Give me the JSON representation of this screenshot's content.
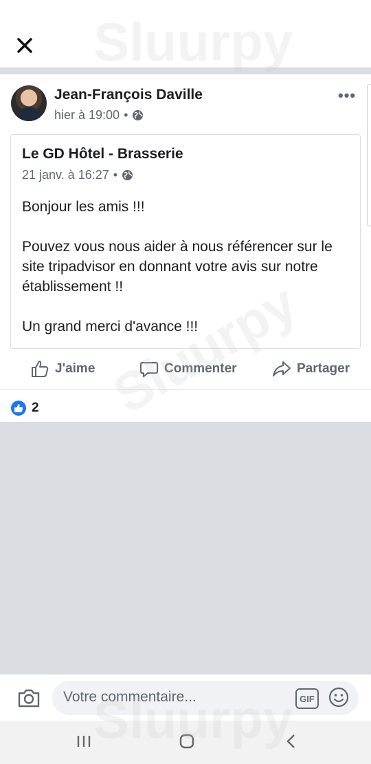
{
  "header": {
    "close_icon": "close-icon"
  },
  "post": {
    "author": "Jean-François Daville",
    "time": "hier à 19:00",
    "separator": "•",
    "privacy_icon": "globe-icon",
    "more_label": "•••",
    "shared": {
      "page_name": "Le GD Hôtel - Brasserie",
      "time": "21 janv. à 16:27",
      "separator": "•",
      "body": [
        "Bonjour les amis !!!",
        "Pouvez vous nous aider à nous référencer sur le site tripadvisor en donnant votre avis sur notre établissement !!",
        "Un grand merci d'avance !!!"
      ]
    },
    "actions": {
      "like": "J'aime",
      "comment": "Commenter",
      "share": "Partager"
    },
    "like_count": "2"
  },
  "comment_bar": {
    "placeholder": "Votre commentaire...",
    "gif_label": "GIF"
  },
  "watermark": "Sluurpy",
  "colors": {
    "accent": "#1877f2",
    "muted": "#606770",
    "background_gray": "#dadde1"
  }
}
